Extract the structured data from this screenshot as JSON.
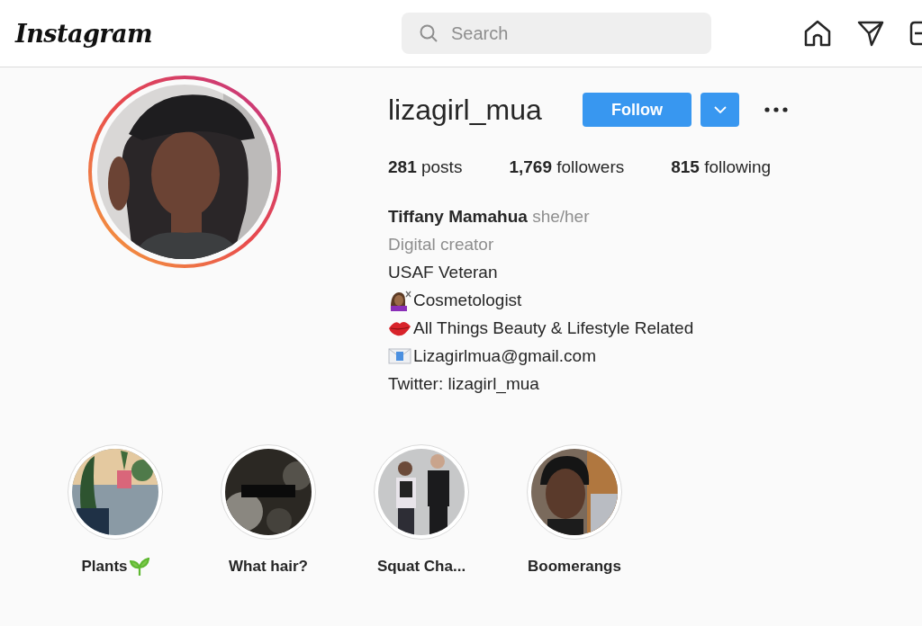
{
  "header": {
    "logo": "Instagram",
    "search": {
      "placeholder": "Search"
    }
  },
  "profile": {
    "username": "lizagirl_mua",
    "follow_label": "Follow",
    "stats": [
      {
        "count": "281",
        "label": "posts"
      },
      {
        "count": "1,769",
        "label": "followers"
      },
      {
        "count": "815",
        "label": "following"
      }
    ],
    "name": "Tiffany Mamahua",
    "pronouns": "she/her",
    "bio": [
      {
        "kind": "category",
        "text": "Digital creator"
      },
      {
        "kind": "plain",
        "text": "USAF Veteran"
      },
      {
        "kind": "hairdresser",
        "text": "Cosmetologist"
      },
      {
        "kind": "lips",
        "text": "All Things Beauty & Lifestyle Related"
      },
      {
        "kind": "envelope",
        "text": "Lizagirlmua@gmail.com"
      },
      {
        "kind": "plain",
        "text": "Twitter: lizagirl_mua"
      }
    ]
  },
  "highlights": [
    {
      "label": "Plants",
      "kind": "plants"
    },
    {
      "label": "What hair?",
      "kind": "dark"
    },
    {
      "label": "Squat Cha...",
      "kind": "people"
    },
    {
      "label": "Boomerangs",
      "kind": "portrait"
    }
  ]
}
